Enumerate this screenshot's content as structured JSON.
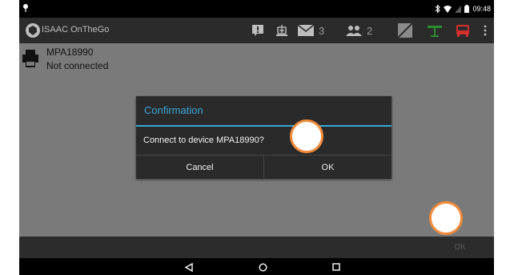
{
  "status_bar": {
    "time": "09:48"
  },
  "app": {
    "title": "ISAAC OnTheGo"
  },
  "action_bar": {
    "messages_count": "3",
    "contacts_count": "2"
  },
  "device": {
    "name": "MPA18990",
    "status": "Not connected"
  },
  "dialog": {
    "title": "Confirmation",
    "message": "Connect to device MPA18990?",
    "cancel_label": "Cancel",
    "ok_label": "OK"
  },
  "bottom_bar": {
    "ok_label": "OK"
  },
  "colors": {
    "accent": "#3aa6d8",
    "touch_ring": "#f28c3c",
    "alert_green": "#2e8b2e",
    "alert_red": "#d32f2f"
  }
}
